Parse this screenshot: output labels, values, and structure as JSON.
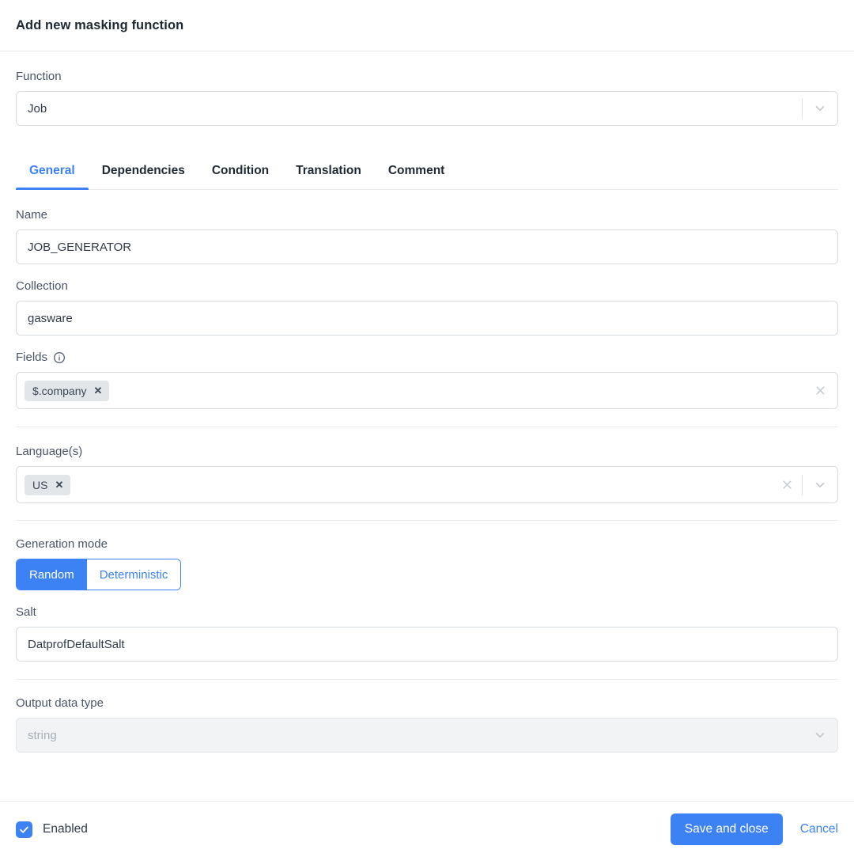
{
  "dialog": {
    "title": "Add new masking function"
  },
  "function_field": {
    "label": "Function",
    "value": "Job",
    "chevron_icon": "chevron-down-icon"
  },
  "tabs": [
    {
      "label": "General",
      "active": true
    },
    {
      "label": "Dependencies",
      "active": false
    },
    {
      "label": "Condition",
      "active": false
    },
    {
      "label": "Translation",
      "active": false
    },
    {
      "label": "Comment",
      "active": false
    }
  ],
  "name_field": {
    "label": "Name",
    "value": "JOB_GENERATOR"
  },
  "collection_field": {
    "label": "Collection",
    "value": "gasware"
  },
  "fields_field": {
    "label": "Fields",
    "info_icon": "info-icon",
    "chips": [
      {
        "label": "$.company",
        "remove_icon": "close-icon"
      }
    ],
    "clear_icon": "clear-icon"
  },
  "languages_field": {
    "label": "Language(s)",
    "chips": [
      {
        "label": "US",
        "remove_icon": "close-icon"
      }
    ],
    "clear_icon": "clear-icon",
    "chevron_icon": "chevron-down-icon"
  },
  "generation_mode": {
    "label": "Generation mode",
    "options": [
      {
        "label": "Random",
        "active": true
      },
      {
        "label": "Deterministic",
        "active": false
      }
    ]
  },
  "salt_field": {
    "label": "Salt",
    "value": "DatprofDefaultSalt"
  },
  "output_type_field": {
    "label": "Output data type",
    "value": "string",
    "disabled": true,
    "chevron_icon": "chevron-down-icon"
  },
  "footer": {
    "enabled_label": "Enabled",
    "enabled_checked": true,
    "check_icon": "check-icon",
    "save_label": "Save and close",
    "cancel_label": "Cancel"
  },
  "colors": {
    "accent": "#3c82f5",
    "text": "#313b49",
    "label": "#4a5568",
    "border": "#d7dce1",
    "divider": "#e8eaed",
    "chip_bg": "#e3e6e9",
    "disabled_bg": "#f1f3f5"
  }
}
